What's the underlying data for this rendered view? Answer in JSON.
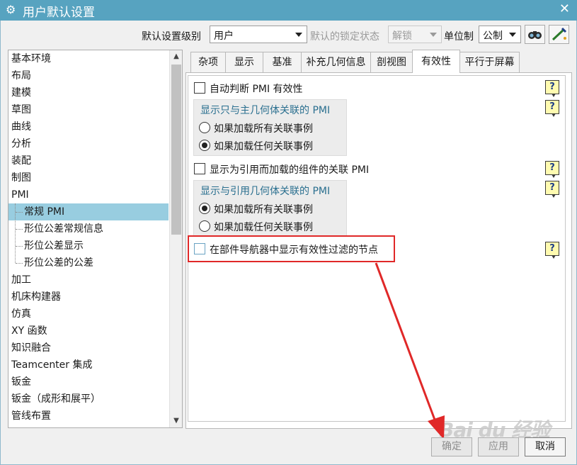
{
  "window": {
    "title": "用户默认设置",
    "close_glyph": "✕"
  },
  "toolbar": {
    "level_label": "默认设置级别",
    "level_value": "用户",
    "lock_label": "默认的锁定状态",
    "lock_value": "解锁",
    "unit_label": "单位制",
    "unit_value": "公制"
  },
  "tree": {
    "items": [
      {
        "label": "基本环境",
        "child": false
      },
      {
        "label": "布局",
        "child": false
      },
      {
        "label": "建模",
        "child": false
      },
      {
        "label": "草图",
        "child": false
      },
      {
        "label": "曲线",
        "child": false
      },
      {
        "label": "分析",
        "child": false
      },
      {
        "label": "装配",
        "child": false
      },
      {
        "label": "制图",
        "child": false
      },
      {
        "label": "PMI",
        "child": false
      },
      {
        "label": "常规 PMI",
        "child": true,
        "selected": true
      },
      {
        "label": "形位公差常规信息",
        "child": true
      },
      {
        "label": "形位公差显示",
        "child": true
      },
      {
        "label": "形位公差的公差",
        "child": true
      },
      {
        "label": "加工",
        "child": false
      },
      {
        "label": "机床构建器",
        "child": false
      },
      {
        "label": "仿真",
        "child": false
      },
      {
        "label": "XY 函数",
        "child": false
      },
      {
        "label": "知识融合",
        "child": false
      },
      {
        "label": "Teamcenter 集成",
        "child": false
      },
      {
        "label": "钣金",
        "child": false
      },
      {
        "label": "钣金（成形和展平）",
        "child": false
      },
      {
        "label": "管线布置",
        "child": false
      }
    ]
  },
  "tabs": [
    "杂项",
    "显示",
    "基准",
    "补充几何信息",
    "剖视图",
    "有效性",
    "平行于屏幕"
  ],
  "active_tab": "有效性",
  "panel": {
    "auto_check_label": "自动判断 PMI 有效性",
    "group1_title": "显示只与主几何体关联的 PMI",
    "group1_opt1": "如果加载所有关联事例",
    "group1_opt2": "如果加载任何关联事例",
    "ref_check_label": "显示为引用而加载的组件的关联 PMI",
    "group2_title": "显示与引用几何体关联的 PMI",
    "group2_opt1": "如果加载所有关联事例",
    "group2_opt2": "如果加载任何关联事例",
    "nav_check_label": "在部件导航器中显示有效性过滤的节点",
    "help_glyph": "?"
  },
  "buttons": {
    "ok": "确定",
    "apply": "应用",
    "cancel": "取消"
  },
  "watermark": "Bai du 经验",
  "colors": {
    "titlebar": "#57a3c0",
    "selection": "#98cde0",
    "highlight_box": "#e02828",
    "arrow": "#e02828"
  }
}
